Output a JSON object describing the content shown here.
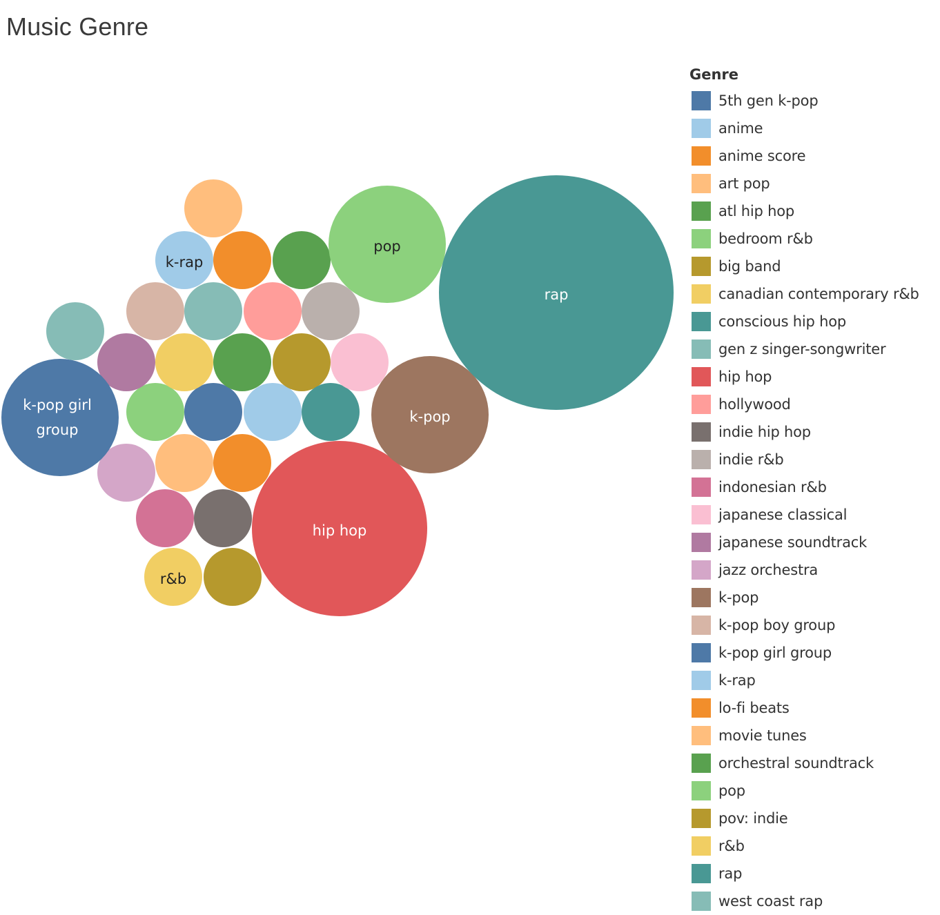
{
  "chart_data": {
    "type": "bubble",
    "title": "Music Genre",
    "legend_title": "Genre",
    "legend_position": "right",
    "size_measure_note": "relative values estimated from bubble area; no values labeled",
    "categories": [
      {
        "name": "5th gen k-pop",
        "color": "#4E79A7",
        "value": 1,
        "label_shown": false
      },
      {
        "name": "anime",
        "color": "#A0CBE8",
        "value": 1,
        "label_shown": false
      },
      {
        "name": "anime score",
        "color": "#F28E2B",
        "value": 1,
        "label_shown": false
      },
      {
        "name": "art pop",
        "color": "#FFBE7D",
        "value": 1,
        "label_shown": false
      },
      {
        "name": "atl hip hop",
        "color": "#59A14F",
        "value": 1,
        "label_shown": false
      },
      {
        "name": "bedroom r&b",
        "color": "#8CD17D",
        "value": 1,
        "label_shown": false
      },
      {
        "name": "big band",
        "color": "#B6992D",
        "value": 1,
        "label_shown": false
      },
      {
        "name": "canadian contemporary r&b",
        "color": "#F1CE63",
        "value": 1,
        "label_shown": false
      },
      {
        "name": "conscious hip hop",
        "color": "#499894",
        "value": 1,
        "label_shown": false
      },
      {
        "name": "gen z singer-songwriter",
        "color": "#86BCB6",
        "value": 1,
        "label_shown": false
      },
      {
        "name": "hip hop",
        "color": "#E15759",
        "value": 9,
        "label_shown": true
      },
      {
        "name": "hollywood",
        "color": "#FF9D9A",
        "value": 1,
        "label_shown": false
      },
      {
        "name": "indie hip hop",
        "color": "#79706E",
        "value": 1,
        "label_shown": false
      },
      {
        "name": "indie r&b",
        "color": "#BAB0AC",
        "value": 1,
        "label_shown": false
      },
      {
        "name": "indonesian r&b",
        "color": "#D37295",
        "value": 1,
        "label_shown": false
      },
      {
        "name": "japanese classical",
        "color": "#FABFD2",
        "value": 1,
        "label_shown": false
      },
      {
        "name": "japanese soundtrack",
        "color": "#B07AA1",
        "value": 1,
        "label_shown": false
      },
      {
        "name": "jazz orchestra",
        "color": "#D4A6C8",
        "value": 1,
        "label_shown": false
      },
      {
        "name": "k-pop",
        "color": "#9D7660",
        "value": 4,
        "label_shown": true
      },
      {
        "name": "k-pop boy group",
        "color": "#D7B5A6",
        "value": 1,
        "label_shown": false
      },
      {
        "name": "k-pop girl group",
        "color": "#4E79A7",
        "value": 4,
        "label_shown": true,
        "label_lines": [
          "k-pop girl",
          "group"
        ]
      },
      {
        "name": "k-rap",
        "color": "#A0CBE8",
        "value": 1,
        "label_shown": true
      },
      {
        "name": "lo-fi beats",
        "color": "#F28E2B",
        "value": 1,
        "label_shown": false
      },
      {
        "name": "movie tunes",
        "color": "#FFBE7D",
        "value": 1,
        "label_shown": false
      },
      {
        "name": "orchestral soundtrack",
        "color": "#59A14F",
        "value": 1,
        "label_shown": false
      },
      {
        "name": "pop",
        "color": "#8CD17D",
        "value": 4,
        "label_shown": true
      },
      {
        "name": "pov: indie",
        "color": "#B6992D",
        "value": 1,
        "label_shown": false
      },
      {
        "name": "r&b",
        "color": "#F1CE63",
        "value": 1,
        "label_shown": true
      },
      {
        "name": "rap",
        "color": "#499894",
        "value": 16,
        "label_shown": true
      },
      {
        "name": "west coast rap",
        "color": "#86BCB6",
        "value": 1,
        "label_shown": false
      }
    ]
  }
}
